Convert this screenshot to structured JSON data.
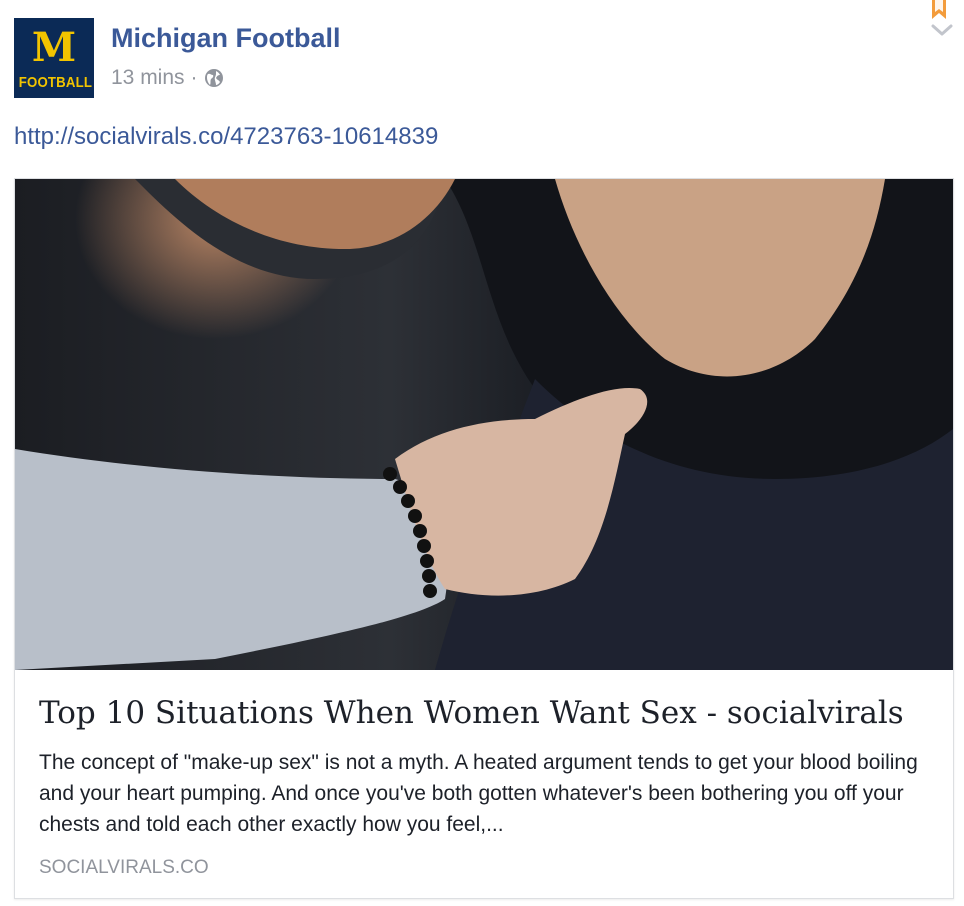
{
  "post": {
    "page_name": "Michigan Football",
    "timestamp": "13 mins",
    "separator": "·",
    "privacy_icon": "globe-icon",
    "link_url": "http://socialvirals.co/4723763-10614839"
  },
  "avatar": {
    "letter": "M",
    "word": "FOOTBALL",
    "bg_color": "#0b2a56",
    "fg_color": "#f2c400"
  },
  "card": {
    "title": "Top 10 Situations When Women Want Sex - socialvirals",
    "description": "The concept of \"make-up sex\" is not a myth. A heated argument tends to get your blood boiling and your heart pumping. And once you've both gotten whatever's been bothering you off your chests and told each other exactly how you feel,...",
    "domain": "SOCIALVIRALS.CO"
  },
  "colors": {
    "link": "#3b5998",
    "muted": "#90949c",
    "text": "#1d2129",
    "bookmark": "#f39c3c"
  }
}
